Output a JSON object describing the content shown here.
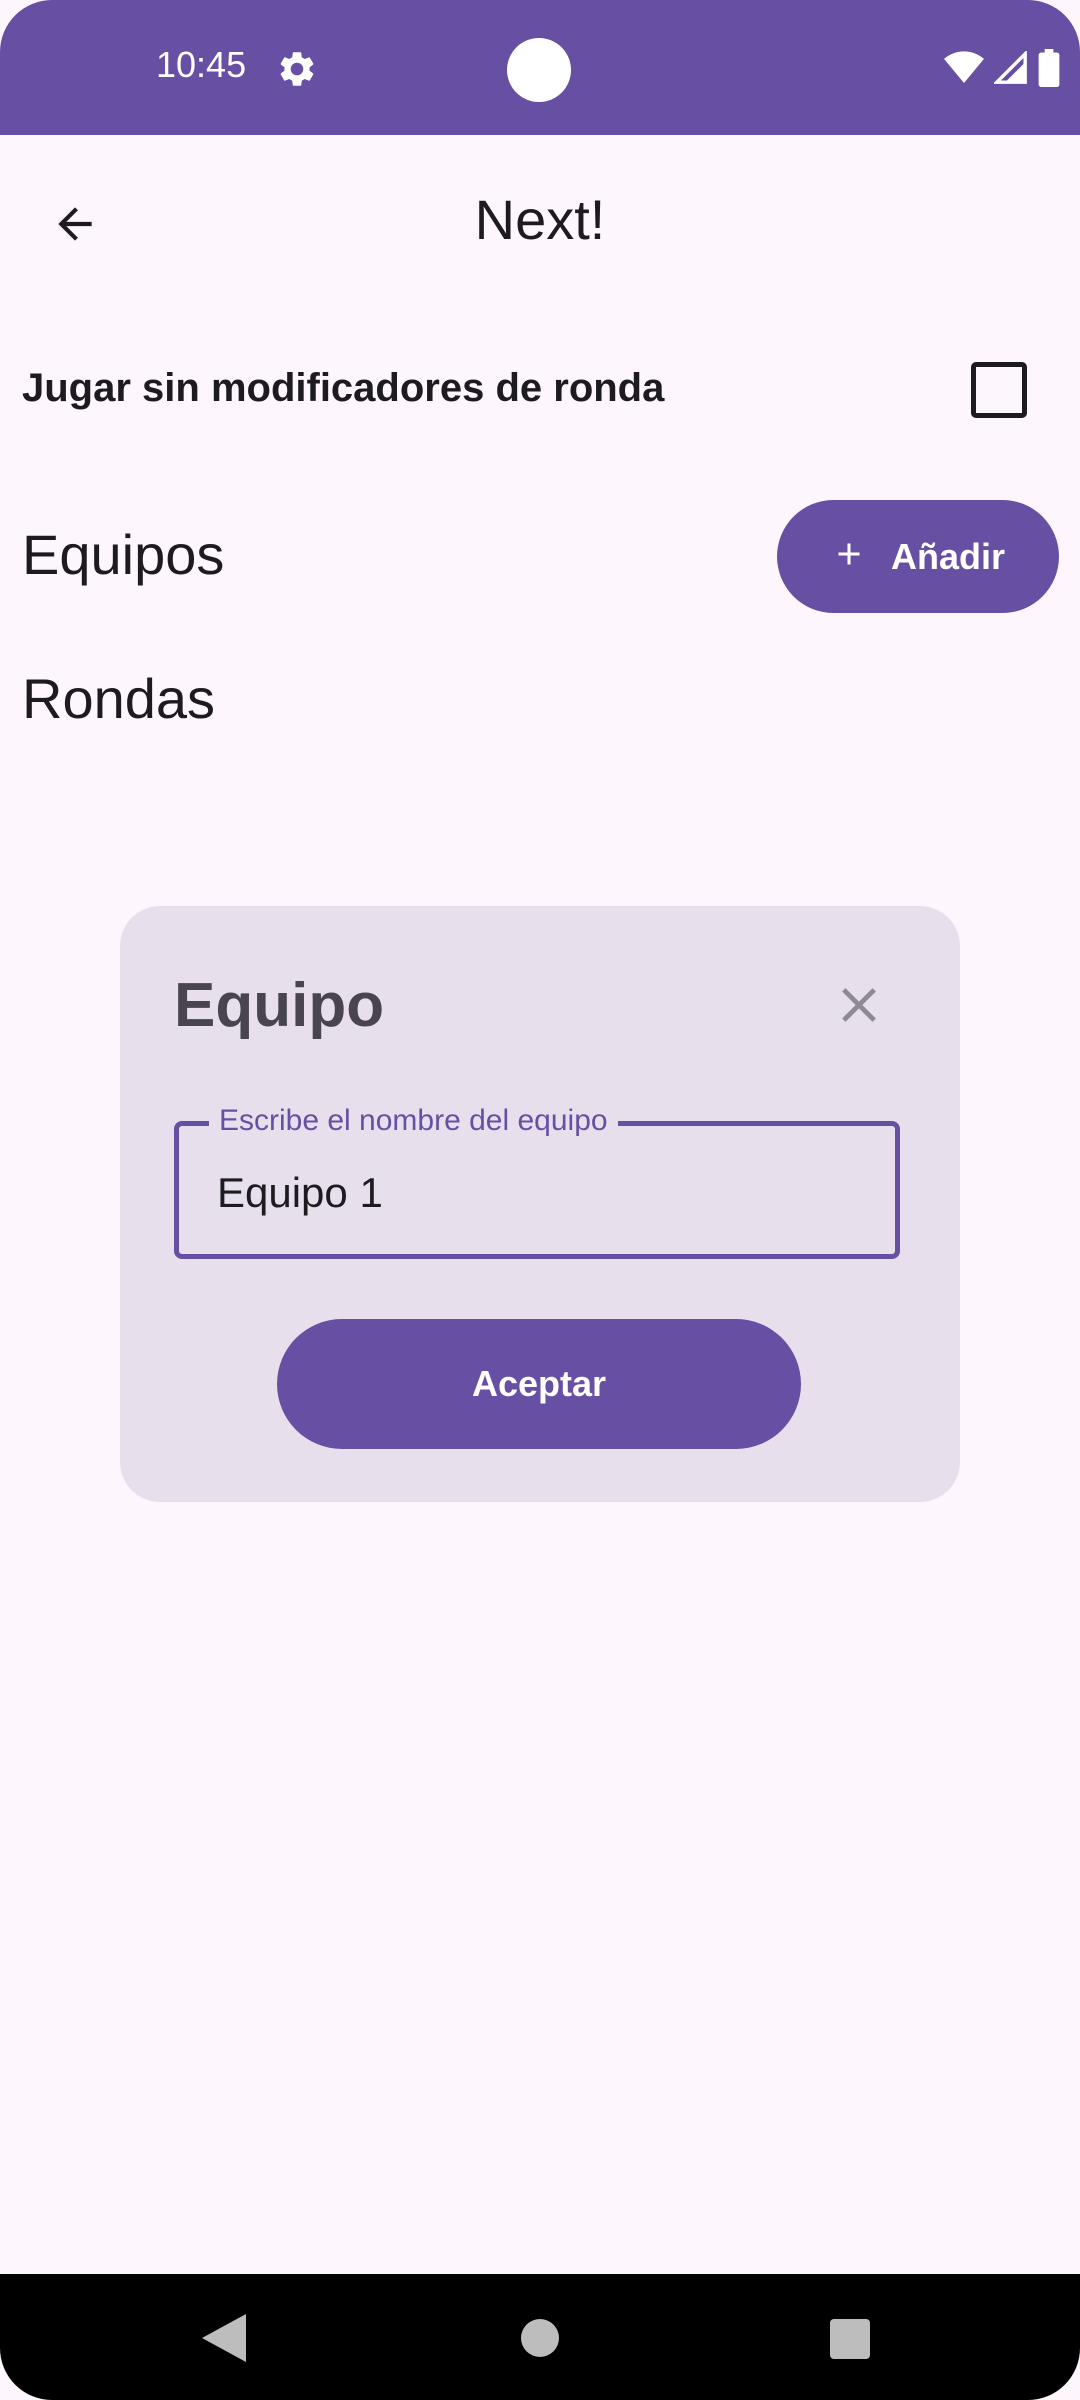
{
  "status_bar": {
    "time": "10:45",
    "icons": [
      "gear-icon",
      "wifi-icon",
      "signal-icon",
      "battery-icon"
    ],
    "background": "#6750a4"
  },
  "app_bar": {
    "title": "Next!",
    "back_icon": "arrow-back-icon"
  },
  "settings": {
    "no_round_modifiers_label": "Jugar sin modificadores de ronda",
    "no_round_modifiers_checked": false
  },
  "sections": {
    "teams_title": "Equipos",
    "rounds_title": "Rondas",
    "add_button_label": "Añadir",
    "add_button_icon": "plus-icon"
  },
  "dialog": {
    "title": "Equipo",
    "close_icon": "close-icon",
    "field_label": "Escribe el nombre del equipo",
    "field_value": "Equipo 1",
    "accept_label": "Aceptar"
  },
  "colors": {
    "primary": "#6750a4",
    "background": "#fdf7fd",
    "dialog_surface": "#e7e0ec",
    "on_surface": "#1d1b20"
  },
  "nav_bar": {
    "icons": [
      "nav-back-icon",
      "nav-home-icon",
      "nav-recents-icon"
    ]
  }
}
